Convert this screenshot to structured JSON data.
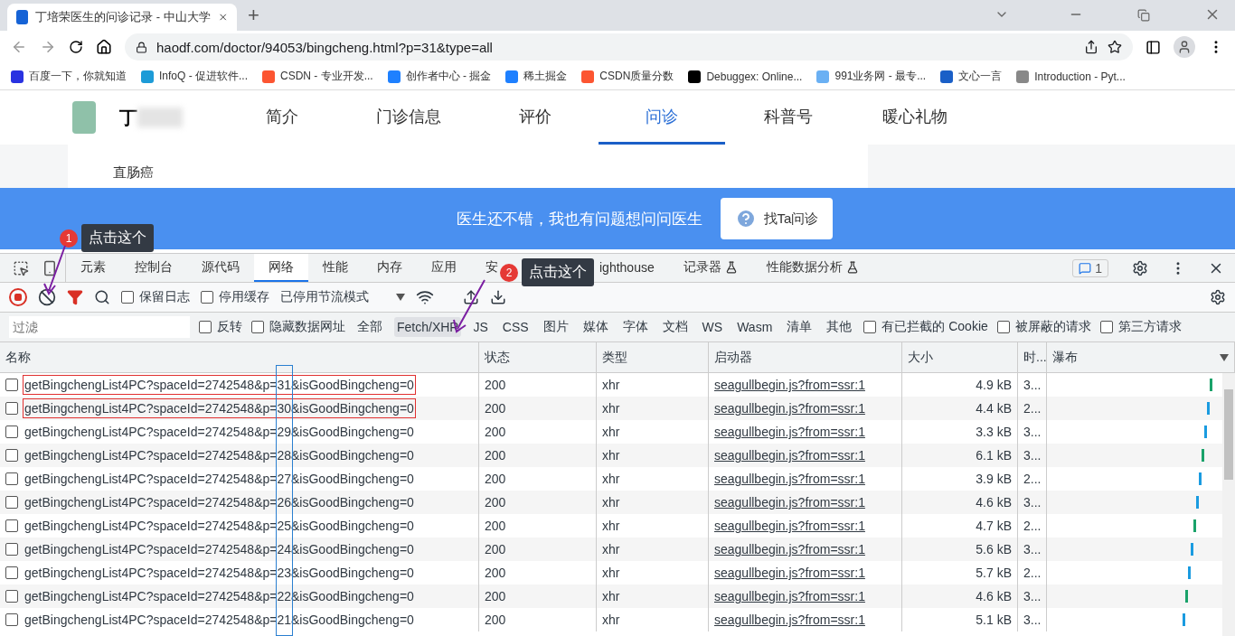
{
  "browser": {
    "tab_title": "丁培荣医生的问诊记录 - 中山大学",
    "new_tab": "+",
    "url": "haodf.com/doctor/94053/bingcheng.html?p=31&type=all",
    "bookmarks": [
      "百度一下，你就知道",
      "InfoQ - 促进软件...",
      "CSDN - 专业开发...",
      "创作者中心 - 掘金",
      "稀土掘金",
      "CSDN质量分数",
      "Debuggex: Online...",
      "991业务网 - 最专...",
      "文心一言",
      "Introduction - Pyt..."
    ]
  },
  "site": {
    "doctor_initial": "丁",
    "nav": [
      {
        "label": "简介",
        "selected": false
      },
      {
        "label": "门诊信息",
        "selected": false
      },
      {
        "label": "评价",
        "selected": false
      },
      {
        "label": "问诊",
        "selected": true
      },
      {
        "label": "科普号",
        "selected": false
      },
      {
        "label": "暖心礼物",
        "selected": false
      }
    ],
    "disease": "直肠癌",
    "banner_text": "医生还不错，我也有问题想问问医生",
    "banner_button": "找Ta问诊"
  },
  "devtools": {
    "tabs": [
      {
        "label": "元素",
        "selected": false
      },
      {
        "label": "控制台",
        "selected": false
      },
      {
        "label": "源代码",
        "selected": false
      },
      {
        "label": "网络",
        "selected": true
      },
      {
        "label": "性能",
        "selected": false
      },
      {
        "label": "内存",
        "selected": false
      },
      {
        "label": "应用",
        "selected": false
      },
      {
        "label": "安",
        "selected": false
      },
      {
        "label": "ighthouse",
        "selected": false
      },
      {
        "label": "记录器",
        "selected": false
      },
      {
        "label": "性能数据分析",
        "selected": false
      }
    ],
    "issues_count": "1",
    "recording": true,
    "preserve_log": {
      "label": "保留日志",
      "checked": false
    },
    "disable_cache": {
      "label": "停用缓存",
      "checked": false
    },
    "throttling": "已停用节流模式",
    "filter_placeholder": "过滤",
    "invert": {
      "label": "反转",
      "checked": false
    },
    "hide_data_urls": {
      "label": "隐藏数据网址",
      "checked": false
    },
    "types": [
      {
        "label": "全部",
        "selected": false
      },
      {
        "label": "Fetch/XHR",
        "selected": true
      },
      {
        "label": "JS",
        "selected": false
      },
      {
        "label": "CSS",
        "selected": false
      },
      {
        "label": "图片",
        "selected": false
      },
      {
        "label": "媒体",
        "selected": false
      },
      {
        "label": "字体",
        "selected": false
      },
      {
        "label": "文档",
        "selected": false
      },
      {
        "label": "WS",
        "selected": false
      },
      {
        "label": "Wasm",
        "selected": false
      },
      {
        "label": "清单",
        "selected": false
      },
      {
        "label": "其他",
        "selected": false
      }
    ],
    "extra_filters": [
      {
        "label": "有已拦截的 Cookie",
        "checked": false
      },
      {
        "label": "被屏蔽的请求",
        "checked": false
      },
      {
        "label": "第三方请求",
        "checked": false
      }
    ],
    "columns": [
      "名称",
      "状态",
      "类型",
      "启动器",
      "大小",
      "时...",
      "瀑布"
    ],
    "rows": [
      {
        "name": "getBingchengList4PC?spaceId=2742548&p=31&isGoodBingcheng=0",
        "status": "200",
        "type": "xhr",
        "initiator": "seagullbegin.js?from=ssr:1",
        "size": "4.9 kB",
        "time": "3...",
        "boxed": true,
        "checked": false
      },
      {
        "name": "getBingchengList4PC?spaceId=2742548&p=30&isGoodBingcheng=0",
        "status": "200",
        "type": "xhr",
        "initiator": "seagullbegin.js?from=ssr:1",
        "size": "4.4 kB",
        "time": "2...",
        "boxed": true,
        "checked": false
      },
      {
        "name": "getBingchengList4PC?spaceId=2742548&p=29&isGoodBingcheng=0",
        "status": "200",
        "type": "xhr",
        "initiator": "seagullbegin.js?from=ssr:1",
        "size": "3.3 kB",
        "time": "3...",
        "boxed": false,
        "checked": false
      },
      {
        "name": "getBingchengList4PC?spaceId=2742548&p=28&isGoodBingcheng=0",
        "status": "200",
        "type": "xhr",
        "initiator": "seagullbegin.js?from=ssr:1",
        "size": "6.1 kB",
        "time": "3...",
        "boxed": false,
        "checked": false
      },
      {
        "name": "getBingchengList4PC?spaceId=2742548&p=27&isGoodBingcheng=0",
        "status": "200",
        "type": "xhr",
        "initiator": "seagullbegin.js?from=ssr:1",
        "size": "3.9 kB",
        "time": "2...",
        "boxed": false,
        "checked": false
      },
      {
        "name": "getBingchengList4PC?spaceId=2742548&p=26&isGoodBingcheng=0",
        "status": "200",
        "type": "xhr",
        "initiator": "seagullbegin.js?from=ssr:1",
        "size": "4.6 kB",
        "time": "3...",
        "boxed": false,
        "checked": false
      },
      {
        "name": "getBingchengList4PC?spaceId=2742548&p=25&isGoodBingcheng=0",
        "status": "200",
        "type": "xhr",
        "initiator": "seagullbegin.js?from=ssr:1",
        "size": "4.7 kB",
        "time": "2...",
        "boxed": false,
        "checked": false
      },
      {
        "name": "getBingchengList4PC?spaceId=2742548&p=24&isGoodBingcheng=0",
        "status": "200",
        "type": "xhr",
        "initiator": "seagullbegin.js?from=ssr:1",
        "size": "5.6 kB",
        "time": "3...",
        "boxed": false,
        "checked": false
      },
      {
        "name": "getBingchengList4PC?spaceId=2742548&p=23&isGoodBingcheng=0",
        "status": "200",
        "type": "xhr",
        "initiator": "seagullbegin.js?from=ssr:1",
        "size": "5.7 kB",
        "time": "2...",
        "boxed": false,
        "checked": false
      },
      {
        "name": "getBingchengList4PC?spaceId=2742548&p=22&isGoodBingcheng=0",
        "status": "200",
        "type": "xhr",
        "initiator": "seagullbegin.js?from=ssr:1",
        "size": "4.6 kB",
        "time": "3...",
        "boxed": false,
        "checked": false
      },
      {
        "name": "getBingchengList4PC?spaceId=2742548&p=21&isGoodBingcheng=0",
        "status": "200",
        "type": "xhr",
        "initiator": "seagullbegin.js?from=ssr:1",
        "size": "5.1 kB",
        "time": "3...",
        "boxed": false,
        "checked": false
      }
    ]
  },
  "callouts": [
    {
      "number": "1",
      "text": "点击这个"
    },
    {
      "number": "2",
      "text": "点击这个"
    }
  ]
}
